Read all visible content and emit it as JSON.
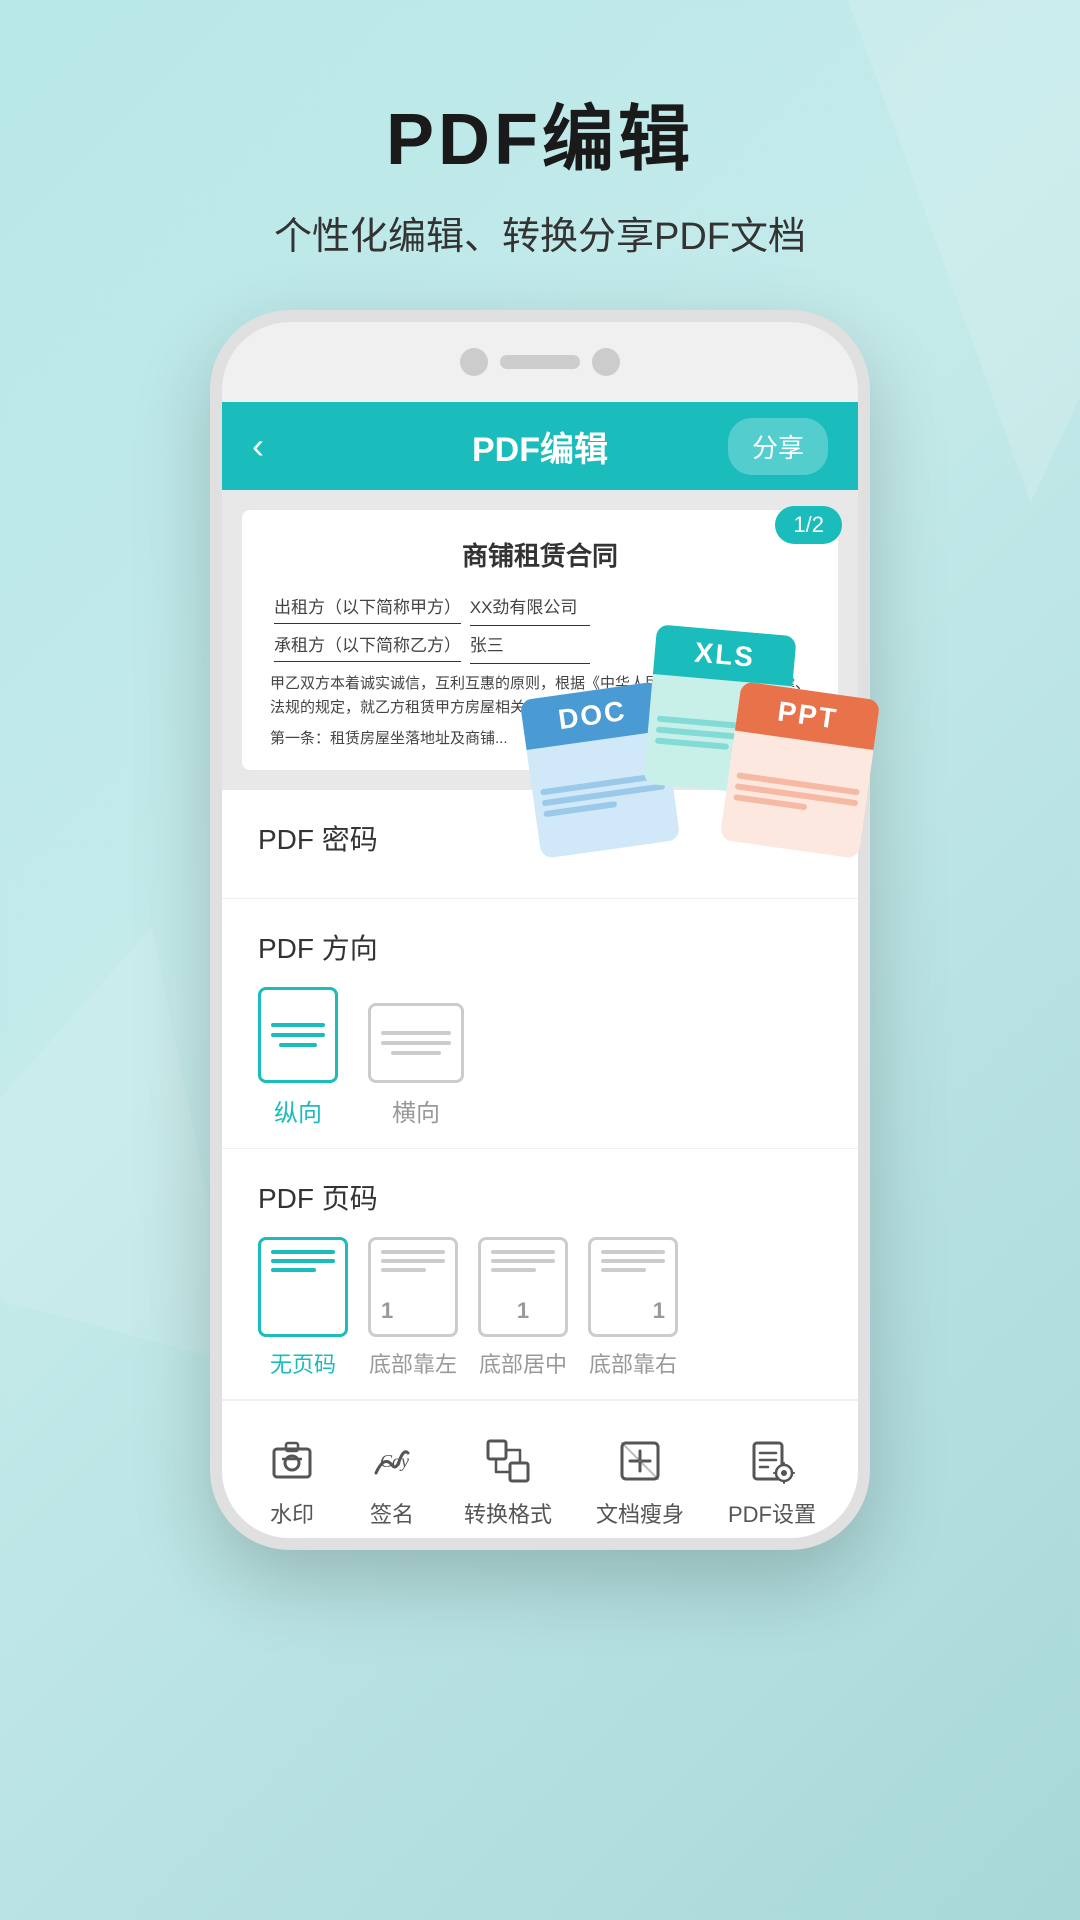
{
  "header": {
    "main_title": "PDF编辑",
    "sub_title": "个性化编辑、转换分享PDF文档"
  },
  "app_bar": {
    "back_icon": "‹",
    "title": "PDF编辑",
    "share_label": "分享"
  },
  "document": {
    "page_badge": "1/2",
    "doc_title": "商铺租赁合同",
    "line1_label": "出租方（以下简称甲方）",
    "line1_value": "XX劲有限公司",
    "line2_label": "承租方（以下简称乙方）",
    "line2_value": "张三",
    "body_text": "甲乙双方本着诚实诚信，互利互惠的原则，根据《中华人民共和国合同法》法律、法规的规定，就乙方租赁甲方房屋相关事宜达成本合同，以兹共同遵守：",
    "article_text": "第一条：租赁房屋坐落地址及商铺..."
  },
  "pdf_password": {
    "label": "PDF 密码"
  },
  "pdf_orientation": {
    "label": "PDF 方向",
    "portrait_label": "纵向",
    "landscape_label": "横向"
  },
  "pdf_pagenum": {
    "label": "PDF 页码",
    "no_pagenum_label": "无页码",
    "bottom_left_label": "底部靠左",
    "bottom_center_label": "底部居中",
    "bottom_right_label": "底部靠右",
    "page_num": "1"
  },
  "toolbar": {
    "items": [
      {
        "id": "watermark",
        "label": "水印"
      },
      {
        "id": "signature",
        "label": "签名"
      },
      {
        "id": "convert",
        "label": "转换格式"
      },
      {
        "id": "slim",
        "label": "文档瘦身"
      },
      {
        "id": "settings",
        "label": "PDF设置"
      }
    ]
  },
  "file_cards": [
    {
      "type": "DOC",
      "class": "doc-card"
    },
    {
      "type": "XLS",
      "class": "xls-card"
    },
    {
      "type": "PPT",
      "class": "ppt-card"
    }
  ],
  "colors": {
    "teal": "#1abcbc",
    "doc_blue": "#4a9bd4",
    "xls_green": "#1abcbc",
    "ppt_orange": "#e8724a"
  }
}
